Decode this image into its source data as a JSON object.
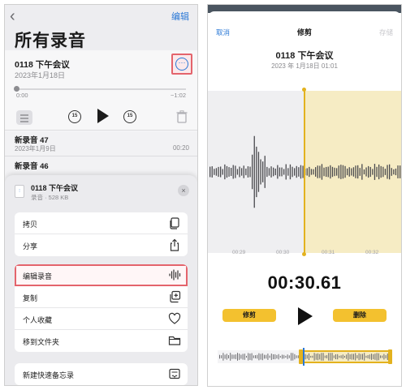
{
  "left": {
    "back_icon": "chevron-left-icon",
    "edit": "编辑",
    "title": "所有录音",
    "expanded": {
      "name": "0118 下午会议",
      "date": "2023年1月18日",
      "time_start": "0:00",
      "time_end": "−1:02",
      "progress": 0.0,
      "skip_back": "15",
      "skip_fwd": "15"
    },
    "recordings": [
      {
        "name": "新录音 47",
        "date": "2023年1月9日",
        "duration": "00:20"
      },
      {
        "name": "新录音 46",
        "date": "",
        "duration": ""
      }
    ],
    "sheet": {
      "title": "0118 下午会议",
      "subtitle": "录音 · 528 KB",
      "close": "×",
      "group1": [
        {
          "label": "拷贝",
          "icon": "copy-icon"
        },
        {
          "label": "分享",
          "icon": "share-icon"
        }
      ],
      "group2": [
        {
          "label": "编辑录音",
          "icon": "waveform-icon",
          "highlighted": true
        },
        {
          "label": "复制",
          "icon": "duplicate-icon"
        },
        {
          "label": "个人收藏",
          "icon": "heart-icon"
        },
        {
          "label": "移到文件夹",
          "icon": "folder-icon"
        }
      ],
      "group3": [
        {
          "label": "新建快速备忘录",
          "icon": "quick-note-icon"
        }
      ]
    }
  },
  "right": {
    "cancel": "取消",
    "title": "修剪",
    "save": "存储",
    "name": "0118 下午会议",
    "date": "2023 年 1月18日  01:01",
    "ticks": [
      "00:29",
      "00:30",
      "00:31",
      "00:32"
    ],
    "current_time": "00:30.61",
    "trim": "修剪",
    "delete": "删除",
    "selection_start": 0.49
  },
  "colors": {
    "accent_blue": "#2a78d6",
    "trim_yellow": "#f3c12f",
    "highlight_red": "#e4646c"
  }
}
